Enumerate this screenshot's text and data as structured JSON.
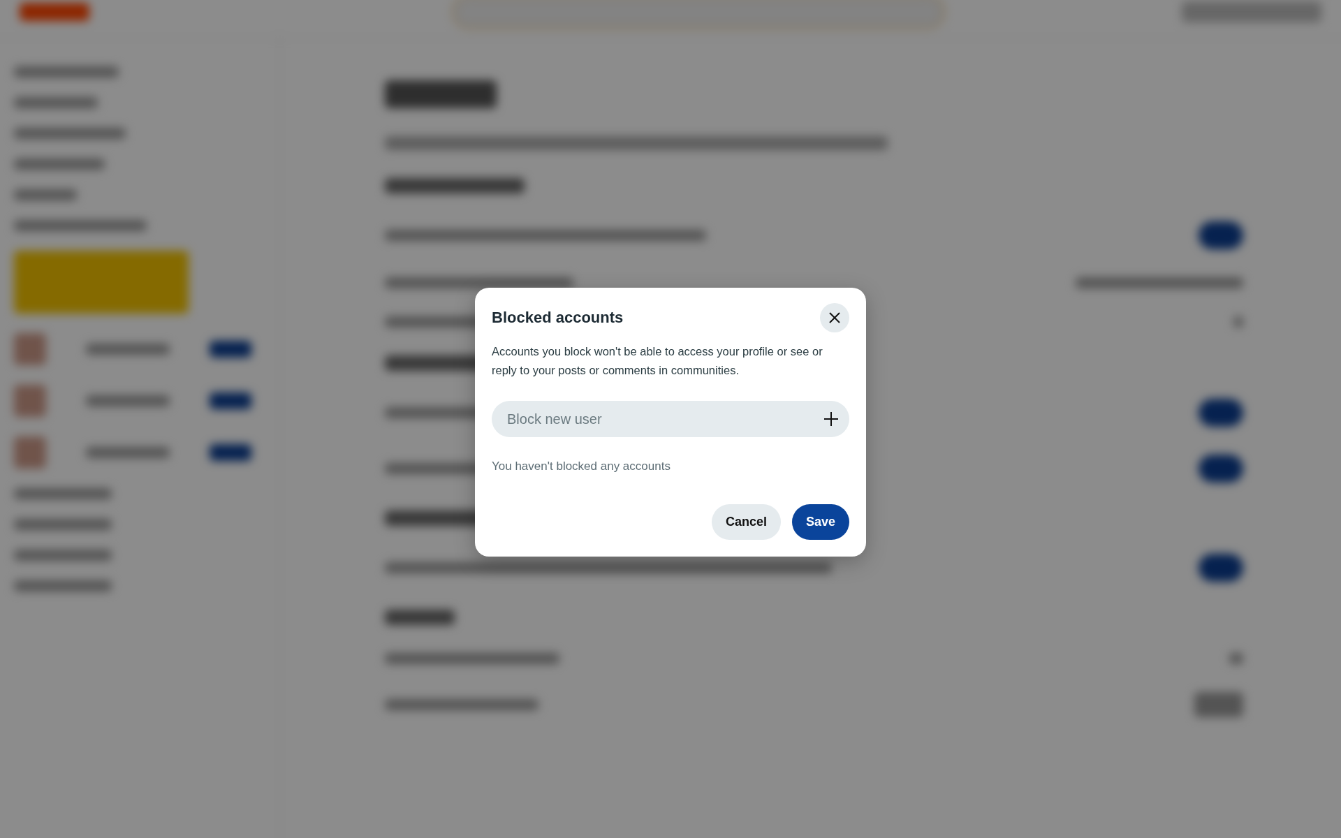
{
  "dialog": {
    "title": "Blocked accounts",
    "description": "Accounts you block won't be able to access your profile or see or reply to your posts or comments in communities.",
    "search": {
      "placeholder": "Block new user"
    },
    "empty_message": "You haven't blocked any accounts",
    "buttons": [
      {
        "label": "Cancel",
        "kind": "secondary"
      },
      {
        "label": "Save",
        "kind": "primary"
      }
    ]
  }
}
